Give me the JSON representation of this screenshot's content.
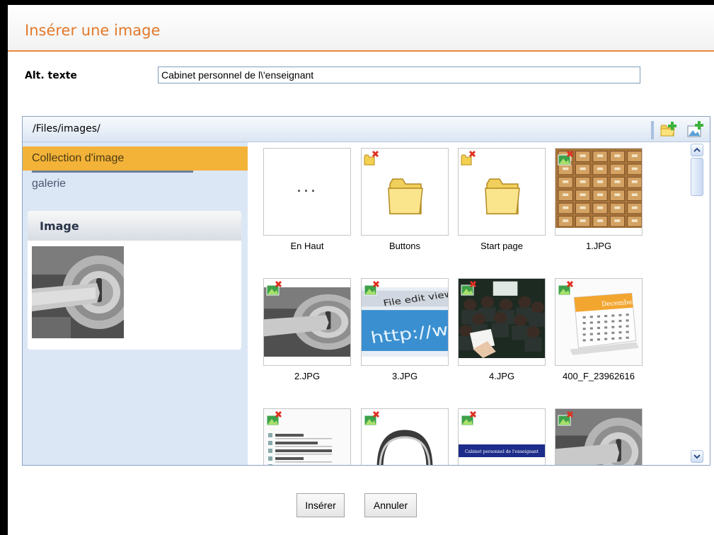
{
  "dialog": {
    "title": "Insérer une image",
    "alt_label": "Alt. texte",
    "alt_value": "Cabinet personnel de l\\'enseignant"
  },
  "browser": {
    "path": "/Files/images/",
    "toolbar": {
      "new_folder_icon": "folder-add-icon",
      "upload_icon": "image-add-icon"
    },
    "collections": [
      {
        "label": "Collection d'image",
        "selected": true
      },
      {
        "label": "galerie",
        "selected": false
      }
    ],
    "preview": {
      "title": "Image"
    },
    "items": [
      {
        "label": "En Haut",
        "type": "up"
      },
      {
        "label": "Buttons",
        "type": "folder"
      },
      {
        "label": "Start page",
        "type": "folder"
      },
      {
        "label": "1.JPG",
        "type": "image"
      },
      {
        "label": "2.JPG",
        "type": "image"
      },
      {
        "label": "3.JPG",
        "type": "image"
      },
      {
        "label": "4.JPG",
        "type": "image"
      },
      {
        "label": "400_F_23962616",
        "type": "image"
      },
      {
        "label": "",
        "type": "image"
      },
      {
        "label": "",
        "type": "image"
      },
      {
        "label": "",
        "type": "image"
      },
      {
        "label": "",
        "type": "image"
      }
    ],
    "thumb_text": {
      "up_dots": "...",
      "browser_url": "http://ww",
      "browser_menu": "File  edit  view",
      "calendar_month": "December",
      "banner": "Cabinet personnel de l'enseignant"
    }
  },
  "buttons": {
    "insert": "Insérer",
    "cancel": "Annuler"
  },
  "colors": {
    "accent": "#e2782a",
    "selected_collection": "#f3b338",
    "panel_bg": "#dce7f5"
  }
}
